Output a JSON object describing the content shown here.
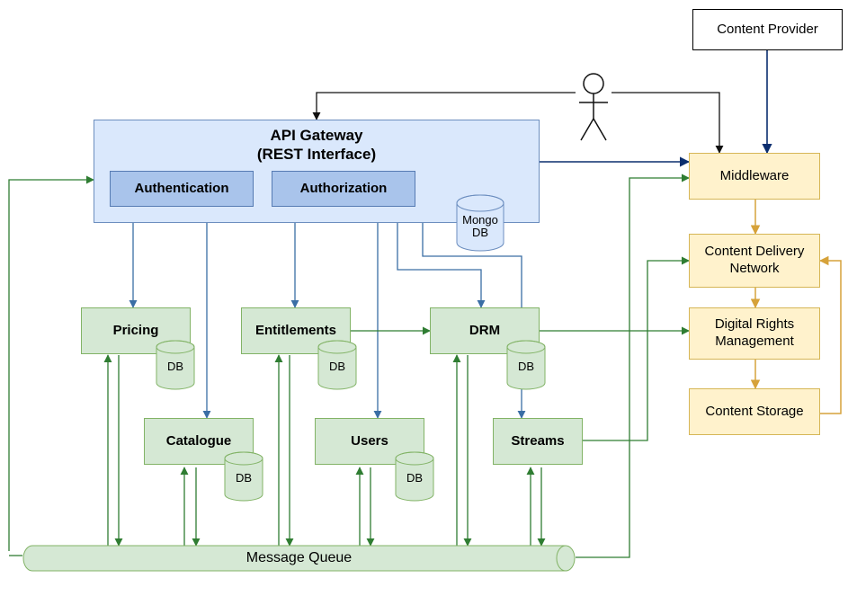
{
  "contentProvider": "Content Provider",
  "apiGateway": {
    "title": "API Gateway\n(REST Interface)",
    "authentication": "Authentication",
    "authorization": "Authorization",
    "mongo": "Mongo\nDB"
  },
  "middleware": {
    "mw": "Middleware",
    "cdn": "Content Delivery\nNetwork",
    "drm": "Digital Rights\nManagement",
    "storage": "Content Storage"
  },
  "services": {
    "pricing": "Pricing",
    "entitlements": "Entitlements",
    "drm": "DRM",
    "catalogue": "Catalogue",
    "users": "Users",
    "streams": "Streams",
    "db": "DB"
  },
  "mq": "Message Queue",
  "colors": {
    "greenStroke": "#2f7d32",
    "blueStroke": "#3a6ea5",
    "orangeStroke": "#d6a23a",
    "blackStroke": "#111"
  }
}
